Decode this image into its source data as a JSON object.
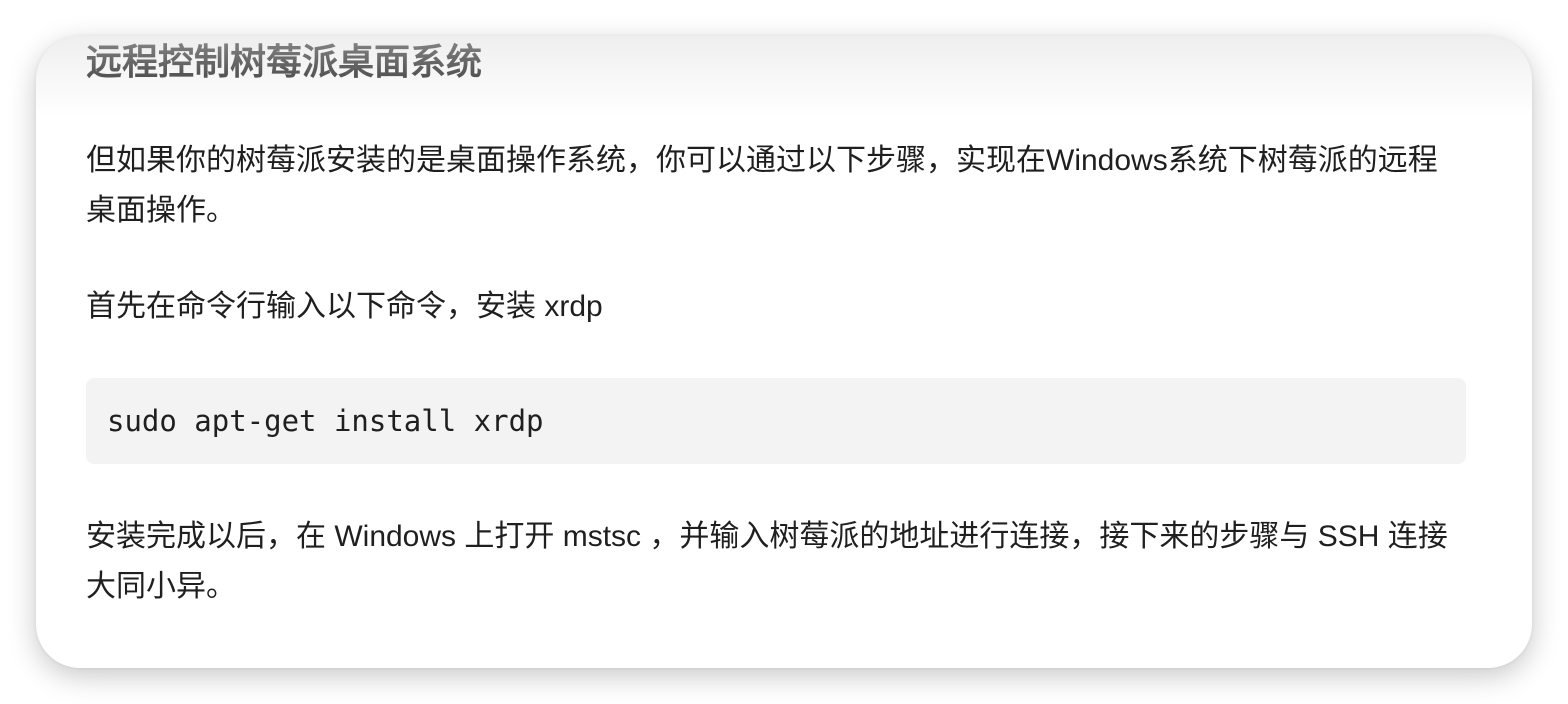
{
  "article": {
    "heading": "远程控制树莓派桌面系统",
    "paragraph_1": "但如果你的树莓派安装的是桌面操作系统，你可以通过以下步骤，实现在Windows系统下树莓派的远程桌面操作。",
    "paragraph_2": "首先在命令行输入以下命令，安装 xrdp",
    "code": "sudo apt-get install xrdp",
    "paragraph_3": "安装完成以后，在 Windows 上打开 mstsc ，并输入树莓派的地址进行连接，接下来的步骤与 SSH 连接大同小异。"
  }
}
